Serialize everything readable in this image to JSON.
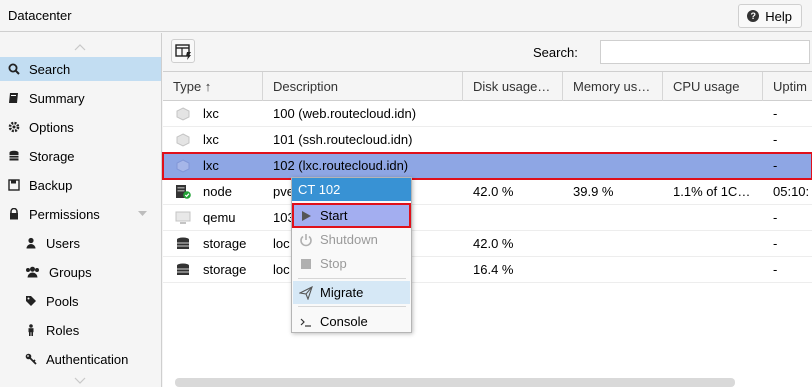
{
  "header": {
    "title": "Datacenter",
    "help_label": "Help"
  },
  "sidebar": {
    "items": [
      {
        "label": "Search",
        "icon": "search-icon"
      },
      {
        "label": "Summary",
        "icon": "book-icon"
      },
      {
        "label": "Options",
        "icon": "gear-icon"
      },
      {
        "label": "Storage",
        "icon": "database-icon"
      },
      {
        "label": "Backup",
        "icon": "floppy-icon"
      },
      {
        "label": "Permissions",
        "icon": "lock-icon"
      },
      {
        "label": "Users",
        "icon": "user-icon"
      },
      {
        "label": "Groups",
        "icon": "users-icon"
      },
      {
        "label": "Pools",
        "icon": "tags-icon"
      },
      {
        "label": "Roles",
        "icon": "male-icon"
      },
      {
        "label": "Authentication",
        "icon": "key-icon"
      }
    ]
  },
  "toolbar": {
    "search_label": "Search:",
    "search_value": ""
  },
  "grid": {
    "columns": [
      "Type ↑",
      "Description",
      "Disk usage…",
      "Memory us…",
      "CPU usage",
      "Uptim"
    ],
    "rows": [
      {
        "type": "lxc",
        "description": "100 (web.routecloud.idn)",
        "disk": "",
        "memory": "",
        "cpu": "",
        "uptime": "-"
      },
      {
        "type": "lxc",
        "description": "101 (ssh.routecloud.idn)",
        "disk": "",
        "memory": "",
        "cpu": "",
        "uptime": "-"
      },
      {
        "type": "lxc",
        "description": "102 (lxc.routecloud.idn)",
        "disk": "",
        "memory": "",
        "cpu": "",
        "uptime": "-"
      },
      {
        "type": "node",
        "description": "pve",
        "disk": "42.0 %",
        "memory": "39.9 %",
        "cpu": "1.1% of 1C…",
        "uptime": "05:10:"
      },
      {
        "type": "qemu",
        "description": "103",
        "disk": "",
        "memory": "",
        "cpu": "",
        "uptime": "-"
      },
      {
        "type": "storage",
        "description": "loc",
        "disk": "42.0 %",
        "memory": "",
        "cpu": "",
        "uptime": "-"
      },
      {
        "type": "storage",
        "description": "loc",
        "disk": "16.4 %",
        "memory": "",
        "cpu": "",
        "uptime": "-"
      }
    ]
  },
  "context_menu": {
    "title": "CT 102",
    "items": [
      "Start",
      "Shutdown",
      "Stop",
      "Migrate",
      "Console"
    ]
  },
  "colors": {
    "selection": "#8ea6e4",
    "menu_header": "#3892d4",
    "highlight_box": "#e0101a"
  }
}
